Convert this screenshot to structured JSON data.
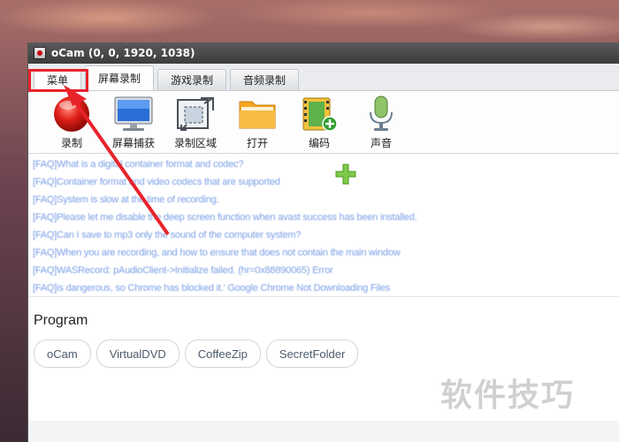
{
  "window": {
    "title": "oCam (0, 0, 1920, 1038)"
  },
  "tabs": [
    {
      "label": "菜单"
    },
    {
      "label": "屏幕录制"
    },
    {
      "label": "游戏录制"
    },
    {
      "label": "音频录制"
    }
  ],
  "toolbar": {
    "record": {
      "label": "录制",
      "icon": "record-icon"
    },
    "capture": {
      "label": "屏幕捕获",
      "icon": "monitor-icon"
    },
    "area": {
      "label": "录制区域",
      "icon": "area-resize-icon"
    },
    "open": {
      "label": "打开",
      "icon": "folder-icon"
    },
    "codec": {
      "label": "编码",
      "icon": "film-add-icon"
    },
    "sound": {
      "label": "声音",
      "icon": "microphone-icon"
    }
  },
  "log": [
    "[FAQ]What is a digital container format and codec?",
    "[FAQ]Container format and video codecs that are supported",
    "[FAQ]System is slow at the time of recording.",
    "[FAQ]Please let me disable the deep screen function when avast success has been installed.",
    "[FAQ]Can I save to mp3 only the sound of the computer system?",
    "[FAQ]When you are recording, and how to ensure that does not contain the main window",
    "[FAQ]WASRecord: pAudioClient->Initialize failed. (hr=0x88890065) Error",
    "[FAQ]is dangerous, so Chrome has blocked it.' Google Chrome Not Downloading Files"
  ],
  "program": {
    "title": "Program",
    "items": [
      "oCam",
      "VirtualDVD",
      "CoffeeZip",
      "SecretFolder"
    ]
  },
  "watermark": "软件技巧",
  "colors": {
    "highlight": "#e8232a",
    "log_text": "#7a9ee6"
  }
}
